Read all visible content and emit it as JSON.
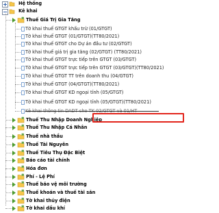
{
  "colors": {
    "highlight_border": "#e2231a",
    "folder_yellow": "#f5c64a",
    "expander_green": "#4f9d2f",
    "tree_line": "#9a9a9a",
    "leaf_icon": "#4a7fc1"
  },
  "tree": {
    "root": {
      "label": "Hệ thống",
      "icon": "expand-plus-icon"
    },
    "section": {
      "label": "Kê khai",
      "icon": "collapse-minus-icon"
    },
    "items": [
      {
        "label": "Thuế Giá Trị Gia Tăng",
        "kind": "folder",
        "expanded": true,
        "bold": true
      },
      {
        "label": "Tờ khai thuế GTGT khấu trừ (01/GTGT)",
        "kind": "leaf"
      },
      {
        "label": "Tờ khai thuế GTGT (01/GTGT)(TT80/2021)",
        "kind": "leaf"
      },
      {
        "label": "Tờ khai thuế GTGT cho Dự án đầu tư (02/GTGT)",
        "kind": "leaf"
      },
      {
        "label": "Tờ khai thuế giá trị gia tăng (02/GTGT) (TT80/2021)",
        "kind": "leaf"
      },
      {
        "label": "Tờ khai thuế GTGT trực tiếp trên GTGT (03/GTGT)",
        "kind": "leaf"
      },
      {
        "label": "Tờ khai thuế GTGT trực tiếp trên GTGT (03/GTGT)(TT80/2021)",
        "kind": "leaf"
      },
      {
        "label": "Tờ khai thuế GTGT TT trên doanh thu (04/GTGT)",
        "kind": "leaf"
      },
      {
        "label": "Tờ khai thuế GTGT (04/GTGT)(TT80/2021)",
        "kind": "leaf"
      },
      {
        "label": "Tờ khai thuế GTGT KD ngoại tỉnh (05/GTGT)",
        "kind": "leaf"
      },
      {
        "label": "Tờ khai thuế GTGT KD ngoại tỉnh (05/GTGT)(TT80/2021)",
        "kind": "leaf",
        "highlighted": true
      },
      {
        "label": "Kê khai thông tin DADT cho TK 02/GTGT và 01/HT",
        "kind": "leaf",
        "striked": true
      },
      {
        "label": "Thuế Thu Nhập Doanh Nghiệp",
        "kind": "folder",
        "bold": true
      },
      {
        "label": "Thuế Thu Nhập Cá Nhân",
        "kind": "folder",
        "bold": true
      },
      {
        "label": "Thuế nhà thầu",
        "kind": "folder",
        "bold": true
      },
      {
        "label": "Thuế Tài Nguyên",
        "kind": "folder",
        "bold": true
      },
      {
        "label": "Thuế Tiêu Thụ Đặc Biệt",
        "kind": "folder",
        "bold": true
      },
      {
        "label": "Báo cáo tài chính",
        "kind": "folder",
        "bold": true
      },
      {
        "label": "Hóa đơn",
        "kind": "folder",
        "bold": true
      },
      {
        "label": "Phí - Lệ Phí",
        "kind": "folder",
        "bold": true
      },
      {
        "label": "Thuế bảo vệ môi trường",
        "kind": "folder",
        "bold": true
      },
      {
        "label": "Thuế khoán và thuế tài sản",
        "kind": "folder",
        "bold": true
      },
      {
        "label": "Tờ khai thủy điện",
        "kind": "folder",
        "bold": true
      },
      {
        "label": "Tờ khai dầu khí",
        "kind": "folder",
        "bold": true
      }
    ]
  }
}
